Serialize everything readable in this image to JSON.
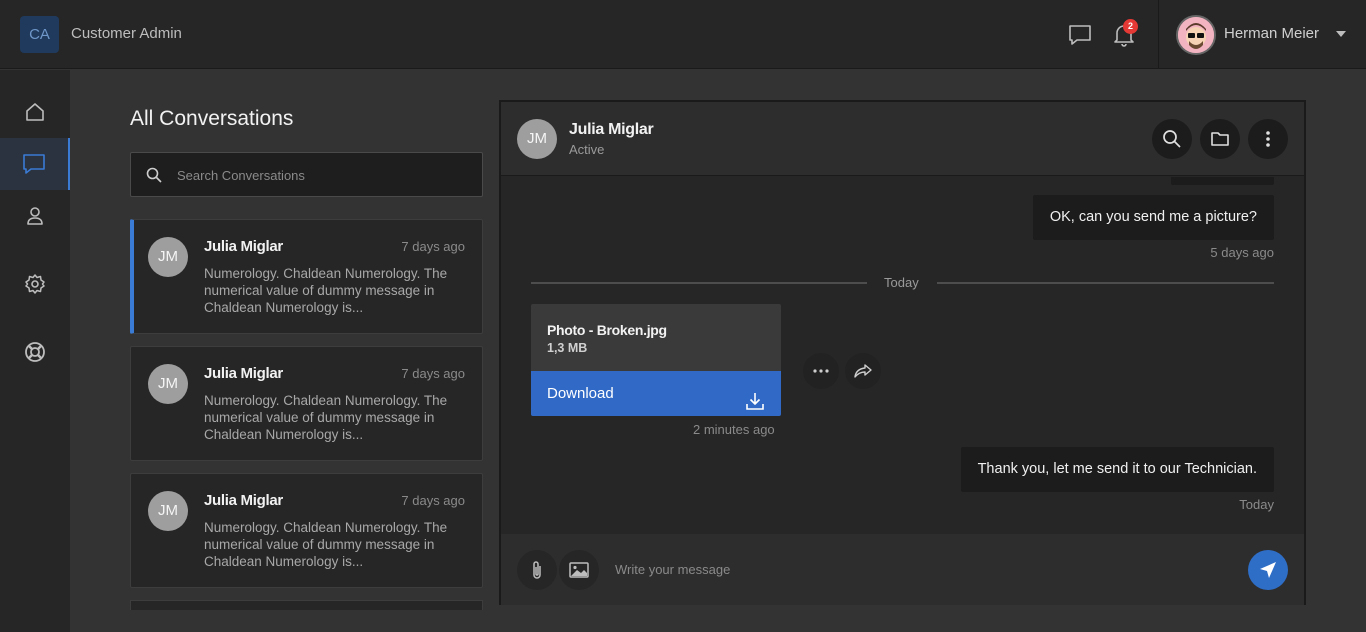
{
  "app": {
    "logo_text": "CA",
    "title": "Customer Admin"
  },
  "topbar": {
    "notifications_count": "2",
    "user_name": "Herman Meier"
  },
  "sidebar": {
    "items": [
      {
        "icon": "home-icon",
        "active": false
      },
      {
        "icon": "chat-icon",
        "active": true
      },
      {
        "icon": "user-icon",
        "active": false
      },
      {
        "icon": "gear-icon",
        "active": false
      },
      {
        "icon": "lifebuoy-icon",
        "active": false
      }
    ]
  },
  "conversations": {
    "title": "All Conversations",
    "search_placeholder": "Search Conversations",
    "items": [
      {
        "initials": "JM",
        "name": "Julia Miglar",
        "time": "7 days ago",
        "snippet": "Numerology. Chaldean Numerology. The numerical value of dummy message in Chaldean Numerology is...",
        "active": true
      },
      {
        "initials": "JM",
        "name": "Julia Miglar",
        "time": "7 days ago",
        "snippet": "Numerology. Chaldean Numerology. The numerical value of dummy message in Chaldean Numerology is...",
        "active": false
      },
      {
        "initials": "JM",
        "name": "Julia Miglar",
        "time": "7 days ago",
        "snippet": "Numerology. Chaldean Numerology. The numerical value of dummy message in Chaldean Numerology is...",
        "active": false
      }
    ]
  },
  "chat": {
    "contact": {
      "initials": "JM",
      "name": "Julia Miglar",
      "status": "Active"
    },
    "messages": {
      "m1_text": "OK, can you send me a picture?",
      "m1_time": "5 days ago",
      "day_separator": "Today",
      "file_name": "Photo - Broken.jpg",
      "file_size": "1,3 MB",
      "download_label": "Download",
      "file_time": "2 minutes ago",
      "m2_text": "Thank you, let me send it to our Technician.",
      "m2_time": "Today"
    },
    "input_placeholder": "Write your message"
  },
  "colors": {
    "accent": "#3a7bd5",
    "download": "#3069c6",
    "badge": "#e53935"
  }
}
